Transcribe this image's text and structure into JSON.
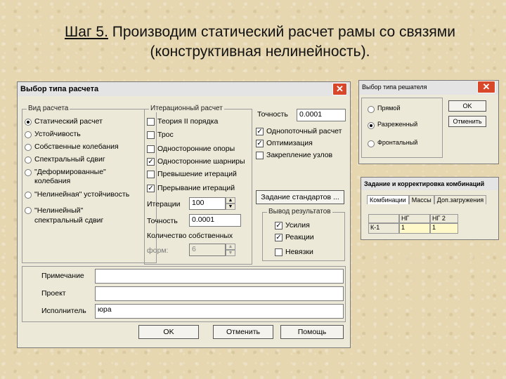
{
  "slide": {
    "step": "Шаг 5.",
    "text_line1": " Производим статический расчет рамы со связями",
    "text_line2": "(конструктивная нелинейность)."
  },
  "main_dialog": {
    "title": "Выбор типа расчета",
    "close_glyph": "✕",
    "calc_type": {
      "label": "Вид расчета",
      "options": [
        {
          "label": "Статический расчет",
          "selected": true
        },
        {
          "label": "Устойчивость",
          "selected": false
        },
        {
          "label": "Собственные колебания",
          "selected": false
        },
        {
          "label": "Спектральный сдвиг",
          "selected": false
        },
        {
          "label": "\"Деформированные\"",
          "label2": "колебания",
          "selected": false
        },
        {
          "label": "\"Нелинейная\" устойчивость",
          "selected": false
        },
        {
          "label": "\"Нелинейный\"",
          "label2": "спектральный сдвиг",
          "selected": false
        }
      ]
    },
    "iteration": {
      "label": "Итерационный расчет",
      "options": [
        {
          "label": "Теория II порядка",
          "checked": false
        },
        {
          "label": "Трос",
          "checked": false
        },
        {
          "label": "Односторонние опоры",
          "checked": false
        },
        {
          "label": "Односторонние шарниры",
          "checked": true
        },
        {
          "label": "Превышение итераций",
          "checked": false
        },
        {
          "label": "Прерывание итераций",
          "checked": true
        }
      ],
      "iterations_label": "Итерации",
      "iterations_value": "100",
      "accuracy_label": "Точность",
      "accuracy_value": "0.0001",
      "eigen_label": "Количество собственных",
      "forms_label": "форм:",
      "forms_value": "6"
    },
    "accuracy_label": "Точность",
    "accuracy_value": "0.0001",
    "right_options": [
      {
        "label": "Однопоточный расчет",
        "checked": true
      },
      {
        "label": "Оптимизация",
        "checked": true
      },
      {
        "label": "Закрепление узлов",
        "checked": false
      }
    ],
    "standards_button": "Задание стандартов ...",
    "output": {
      "label": "Вывод результатов",
      "options": [
        {
          "label": "Усилия",
          "checked": true
        },
        {
          "label": "Реакции",
          "checked": true
        },
        {
          "label": "Невязки",
          "checked": false
        }
      ]
    },
    "fields": {
      "note_label": "Примечание",
      "note_value": "",
      "project_label": "Проект",
      "project_value": "",
      "author_label": "Исполнитель",
      "author_value": "юра"
    },
    "buttons": {
      "ok": "OK",
      "cancel": "Отменить",
      "help": "Помощь"
    }
  },
  "solver_dialog": {
    "title": "Выбор типа решателя",
    "close_glyph": "✕",
    "options": [
      {
        "label": "Прямой",
        "selected": false
      },
      {
        "label": "Разреженный",
        "selected": true
      },
      {
        "label": "Фронтальный",
        "selected": false
      }
    ],
    "ok": "OK",
    "cancel": "Отменить"
  },
  "combo_dialog": {
    "title": "Задание и корректировка комбинаций",
    "tabs": [
      "Комбинации",
      "Массы",
      "Доп.загружения"
    ],
    "header": [
      "НГ",
      "НГ 2"
    ],
    "row_label": "К-1",
    "row_values": [
      "1",
      "1"
    ]
  }
}
